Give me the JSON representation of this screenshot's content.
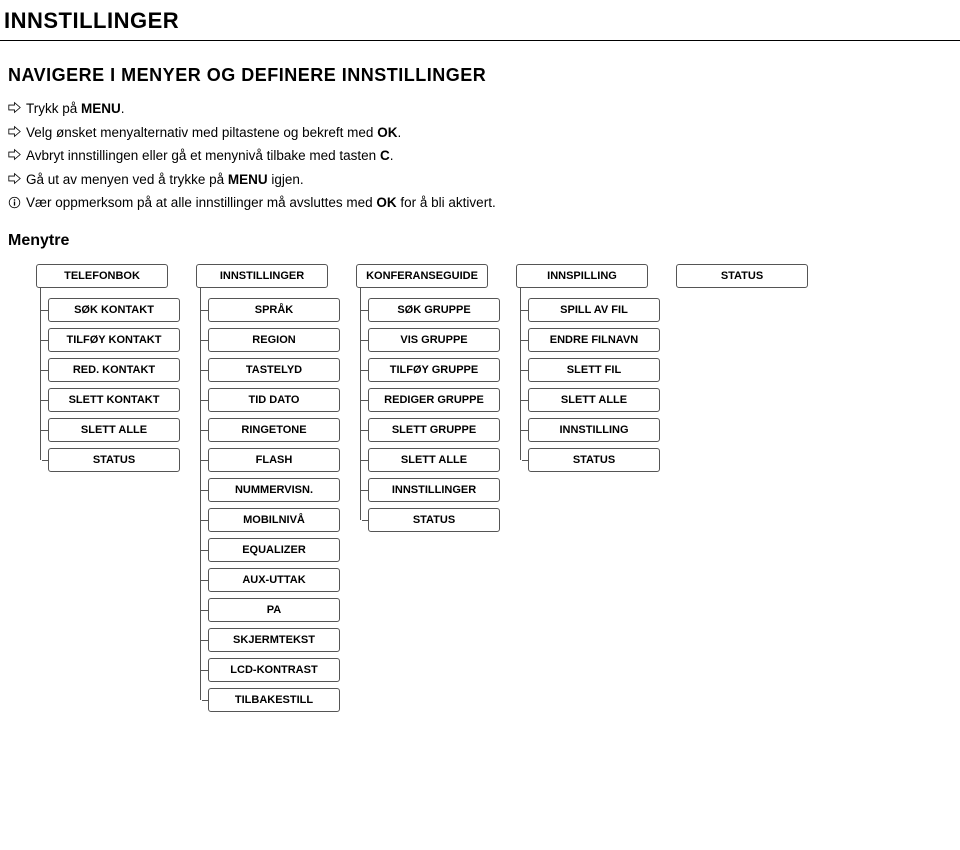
{
  "page_title": "INNSTILLINGER",
  "subtitle": "NAVIGERE I MENYER OG DEFINERE INNSTILLINGER",
  "bullets": [
    {
      "icon": "arrow",
      "pre": "Trykk på ",
      "bold": "MENU",
      "post": "."
    },
    {
      "icon": "arrow",
      "pre": "Velg ønsket menyalternativ med piltastene og bekreft med ",
      "bold": "OK",
      "post": "."
    },
    {
      "icon": "arrow",
      "pre": "Avbryt innstillingen eller gå et menynivå tilbake med tasten ",
      "bold": "C",
      "post": "."
    },
    {
      "icon": "arrow",
      "pre": "Gå ut av menyen ved å trykke på ",
      "bold": "MENU",
      "post": " igjen."
    },
    {
      "icon": "info",
      "pre": "Vær oppmerksom på at alle innstillinger må avsluttes med ",
      "bold": "OK",
      "post": " for å bli aktivert."
    }
  ],
  "menytre_label": "Menytre",
  "tree": {
    "col1": {
      "head": "TELEFONBOK",
      "items": [
        "SØK KONTAKT",
        "TILFØY KONTAKT",
        "RED. KONTAKT",
        "SLETT KONTAKT",
        "SLETT ALLE",
        "STATUS"
      ]
    },
    "col2": {
      "head": "INNSTILLINGER",
      "items": [
        "SPRÅK",
        "REGION",
        "TASTELYD",
        "TID DATO",
        "RINGETONE",
        "FLASH",
        "NUMMERVISN.",
        "MOBILNIVÅ",
        "EQUALIZER",
        "AUX-UTTAK",
        "PA",
        "SKJERMTEKST",
        "LCD-KONTRAST",
        "TILBAKESTILL"
      ]
    },
    "col3": {
      "head": "KONFERANSEGUIDE",
      "items": [
        "SØK GRUPPE",
        "VIS GRUPPE",
        "TILFØY GRUPPE",
        "REDIGER GRUPPE",
        "SLETT GRUPPE",
        "SLETT ALLE",
        "INNSTILLINGER",
        "STATUS"
      ]
    },
    "col4": {
      "head": "INNSPILLING",
      "items": [
        "SPILL AV FIL",
        "ENDRE FILNAVN",
        "SLETT FIL",
        "SLETT ALLE",
        "INNSTILLING",
        "STATUS"
      ]
    },
    "col5": {
      "head": "STATUS",
      "items": []
    }
  }
}
